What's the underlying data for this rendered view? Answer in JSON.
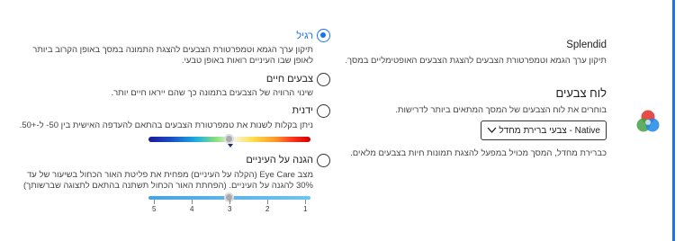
{
  "display_profiles": {
    "splendid": {
      "title": "Splendid",
      "description": "תיקון ערך הגמא וטמפרטורת הצבעים להצגת הצבעים האופטימליים במסך."
    },
    "palette": {
      "title": "לוח צבעים",
      "description": "בוחרים את לוח הצבעים של המסך המתאים ביותר לדרישות.",
      "selected": "Native - צבעי ברירת מחדל",
      "note": "כברירת מחדל, המסך מכויל במפעל להצגת תמונות חיות בצבעים מלאים."
    }
  },
  "options": [
    {
      "title": "רגיל",
      "description": "תיקון ערך הגמא וטמפרטורת הצבעים להצגת התמונה במסך באופן הקרוב ביותר לאופן שבו העיניים רואות באופן טבעי.",
      "checked": true
    },
    {
      "title": "צבעים חיים",
      "description": "שינוי הרוויה של הצבעים בתמונה כך שהם ייראו חיים יותר.",
      "checked": false
    },
    {
      "title": "ידנית",
      "description": "ניתן בקלות לשנות  את טמפרטורת הצבעים בהתאם להעדפה האישית בין 50- ל-+50.",
      "checked": false,
      "slider_value": 0
    },
    {
      "title": "הגנה על העיניים",
      "description": "מצב Eye Care (הקלה על העיניים) מפחית את פליטת האור הכחול בשיעור של עד 30% להגנה על העיניים. (הפחתת האור הכחול תשתנה בהתאם לתצוגה שברשותך)",
      "checked": false,
      "slider_value": 3,
      "ticks": [
        "5",
        "4",
        "3",
        "2",
        "1"
      ]
    }
  ],
  "colors": {
    "accent": "#1a73e8"
  },
  "icons": {
    "palette": "rgb-circles-icon",
    "dropdown": "chevron-down-icon"
  }
}
